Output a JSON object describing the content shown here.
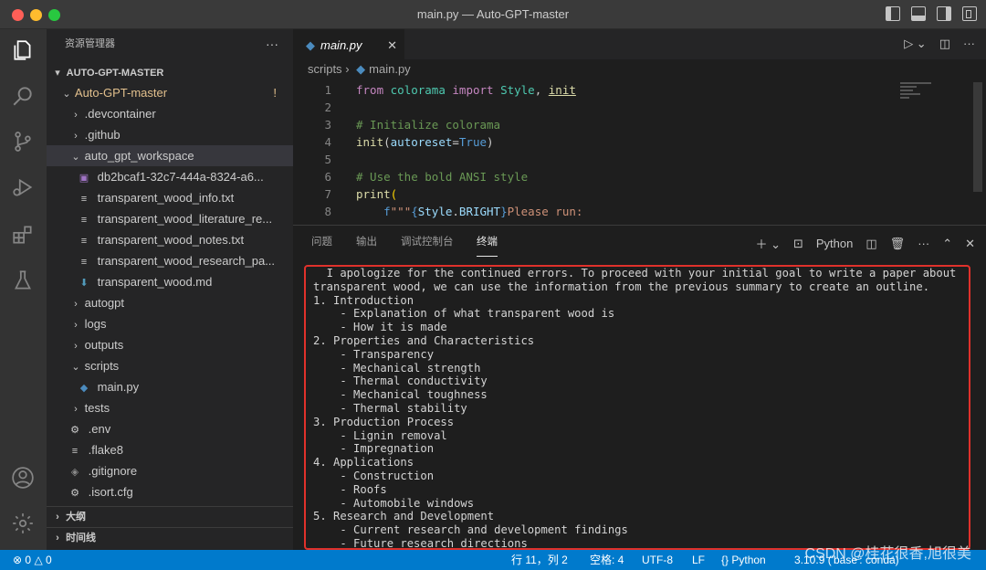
{
  "window": {
    "title": "main.py — Auto-GPT-master"
  },
  "sidebar": {
    "header": "资源管理器",
    "more": "···",
    "root": "AUTO-GPT-MASTER",
    "items": [
      {
        "label": "Auto-GPT-master",
        "badge": "!"
      },
      {
        "label": ".devcontainer"
      },
      {
        "label": ".github"
      },
      {
        "label": "auto_gpt_workspace"
      },
      {
        "label": "db2bcaf1-32c7-444a-8324-a6..."
      },
      {
        "label": "transparent_wood_info.txt"
      },
      {
        "label": "transparent_wood_literature_re..."
      },
      {
        "label": "transparent_wood_notes.txt"
      },
      {
        "label": "transparent_wood_research_pa..."
      },
      {
        "label": "transparent_wood.md"
      },
      {
        "label": "autogpt"
      },
      {
        "label": "logs"
      },
      {
        "label": "outputs"
      },
      {
        "label": "scripts"
      },
      {
        "label": "main.py"
      },
      {
        "label": "tests"
      },
      {
        "label": ".env"
      },
      {
        "label": ".flake8"
      },
      {
        "label": ".gitignore"
      },
      {
        "label": ".isort.cfg"
      }
    ],
    "outline": "大纲",
    "timeline": "时间线"
  },
  "editor": {
    "tab": "main.py",
    "breadcrumb": [
      "scripts",
      "main.py"
    ],
    "line_numbers": [
      "1",
      "2",
      "3",
      "4",
      "5",
      "6",
      "7",
      "8"
    ],
    "lines": [
      "from colorama import Style, init",
      "",
      "# Initialize colorama",
      "init(autoreset=True)",
      "",
      "# Use the bold ANSI style",
      "print(",
      "    f\"\"\"{Style.BRIGHT}Please run:"
    ]
  },
  "panel": {
    "tabs": [
      "问题",
      "输出",
      "调试控制台",
      "终端"
    ],
    "active_tab": "终端",
    "shell": "Python",
    "terminal_text": "  I apologize for the continued errors. To proceed with your initial goal to write a paper about\ntransparent wood, we can use the information from the previous summary to create an outline.\n1. Introduction\n    - Explanation of what transparent wood is\n    - How it is made\n2. Properties and Characteristics\n    - Transparency\n    - Mechanical strength\n    - Thermal conductivity\n    - Mechanical toughness\n    - Thermal stability\n3. Production Process\n    - Lignin removal\n    - Impregnation\n4. Applications\n    - Construction\n    - Roofs\n    - Automobile windows\n5. Research and Development\n    - Current research and development findings\n    - Future research directions"
  },
  "statusbar": {
    "errors": "0",
    "warnings": "0",
    "position": "行 11，列 2",
    "spaces": "空格: 4",
    "encoding": "UTF-8",
    "eol": "LF",
    "language": "Python",
    "interpreter": "3.10.9 ('base': conda)"
  },
  "watermark": "CSDN @桂花很香,旭很美",
  "colors": {
    "statusbar": "#007acc",
    "highlight_box": "#e0312b"
  }
}
